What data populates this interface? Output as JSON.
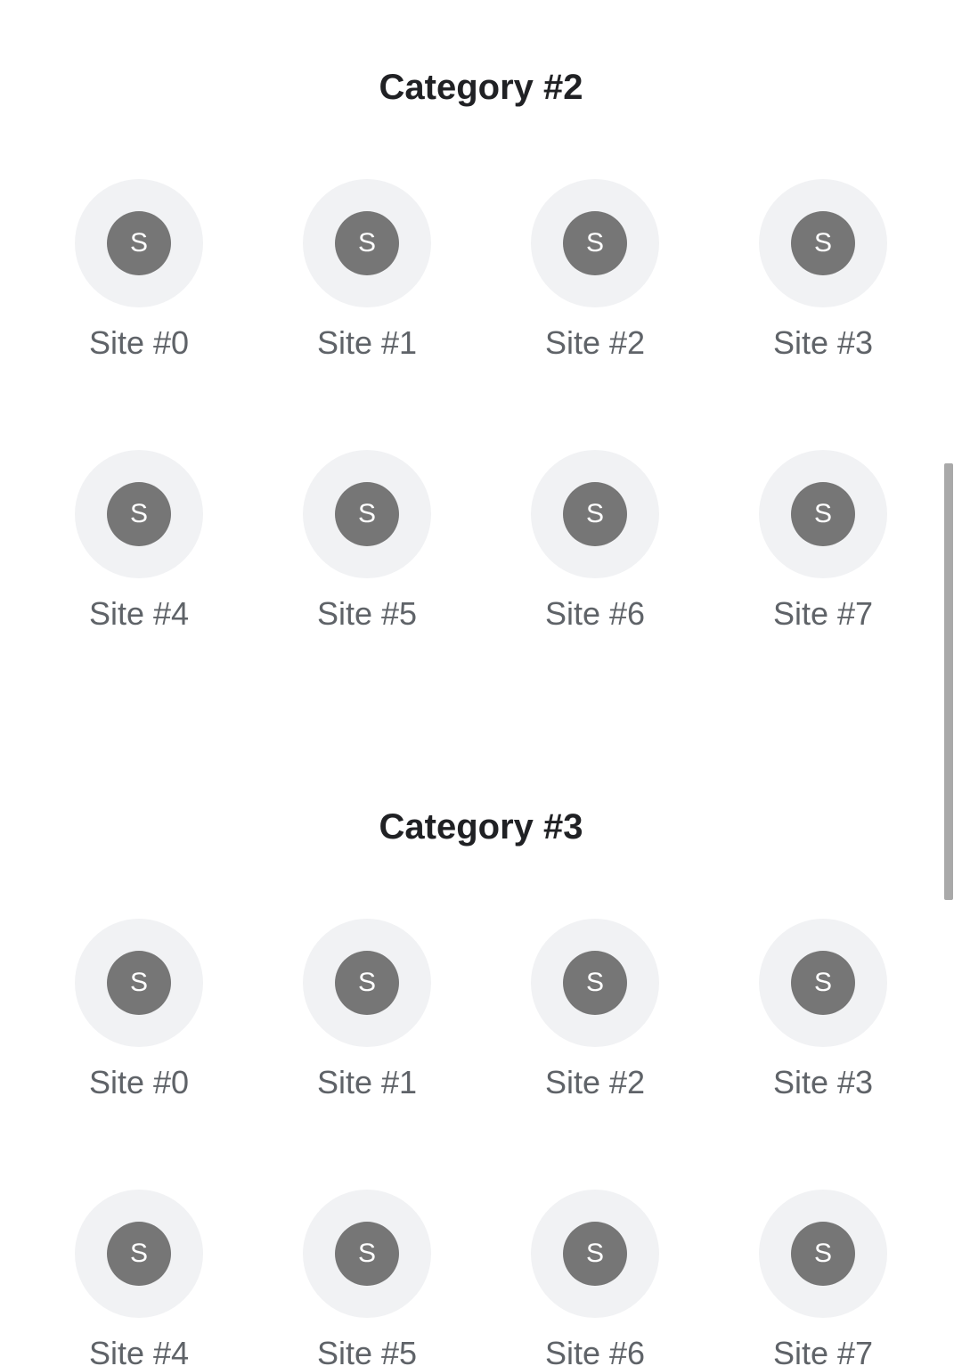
{
  "categories": [
    {
      "title": "Category #2",
      "sites": [
        {
          "letter": "S",
          "label": "Site #0"
        },
        {
          "letter": "S",
          "label": "Site #1"
        },
        {
          "letter": "S",
          "label": "Site #2"
        },
        {
          "letter": "S",
          "label": "Site #3"
        },
        {
          "letter": "S",
          "label": "Site #4"
        },
        {
          "letter": "S",
          "label": "Site #5"
        },
        {
          "letter": "S",
          "label": "Site #6"
        },
        {
          "letter": "S",
          "label": "Site #7"
        }
      ]
    },
    {
      "title": "Category #3",
      "sites": [
        {
          "letter": "S",
          "label": "Site #0"
        },
        {
          "letter": "S",
          "label": "Site #1"
        },
        {
          "letter": "S",
          "label": "Site #2"
        },
        {
          "letter": "S",
          "label": "Site #3"
        },
        {
          "letter": "S",
          "label": "Site #4"
        },
        {
          "letter": "S",
          "label": "Site #5"
        },
        {
          "letter": "S",
          "label": "Site #6"
        },
        {
          "letter": "S",
          "label": "Site #7"
        }
      ]
    }
  ],
  "colors": {
    "tile_background": "#f1f2f4",
    "icon_background": "#767676",
    "icon_letter": "#ffffff",
    "label_text": "#5f6368",
    "title_text": "#202124",
    "scrollbar": "#a9a9a9"
  }
}
